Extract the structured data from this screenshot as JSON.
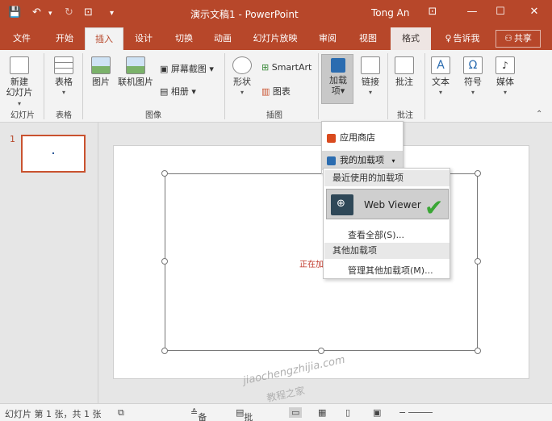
{
  "window": {
    "doc_title": "演示文稿1 - PowerPoint",
    "user": "Tong An",
    "accent": "#b7472a",
    "share_label": "共享",
    "tell_me": "告诉我"
  },
  "tabs": [
    {
      "label": "文件"
    },
    {
      "label": "开始"
    },
    {
      "label": "插入"
    },
    {
      "label": "设计"
    },
    {
      "label": "切换"
    },
    {
      "label": "动画"
    },
    {
      "label": "幻灯片放映"
    },
    {
      "label": "审阅"
    },
    {
      "label": "视图"
    },
    {
      "label": "格式"
    }
  ],
  "ribbon": {
    "new_slide": "新建",
    "new_slide2": "幻灯片",
    "table": "表格",
    "picture": "图片",
    "online_picture": "联机图片",
    "screenshot": "屏幕截图",
    "album": "相册",
    "shapes": "形状",
    "smartart": "SmartArt",
    "chart": "图表",
    "addins": "加载",
    "addins2": "项",
    "link": "链接",
    "comment": "批注",
    "text": "文本",
    "symbol": "符号",
    "media": "媒体",
    "groups": {
      "slides": "幻灯片",
      "tables": "表格",
      "images": "图像",
      "illustrations": "插图",
      "comments": "批注"
    }
  },
  "slide_panel": {
    "number": "1"
  },
  "slide": {
    "loading_text": "正在加"
  },
  "addins_menu": {
    "store": "应用商店",
    "my_addins": "我的加载项",
    "recent_header": "最近使用的加载项",
    "web_viewer": "Web Viewer",
    "see_all": "查看全部(S)...",
    "other_header": "其他加载项",
    "manage_other": "管理其他加载项(M)..."
  },
  "statusbar": {
    "slide_info": "幻灯片 第 1 张，共 1 张",
    "notes": "备注",
    "comments": "批注"
  },
  "watermark": {
    "line1": "jiaochengzhijia.com",
    "line2": "教程之家"
  }
}
